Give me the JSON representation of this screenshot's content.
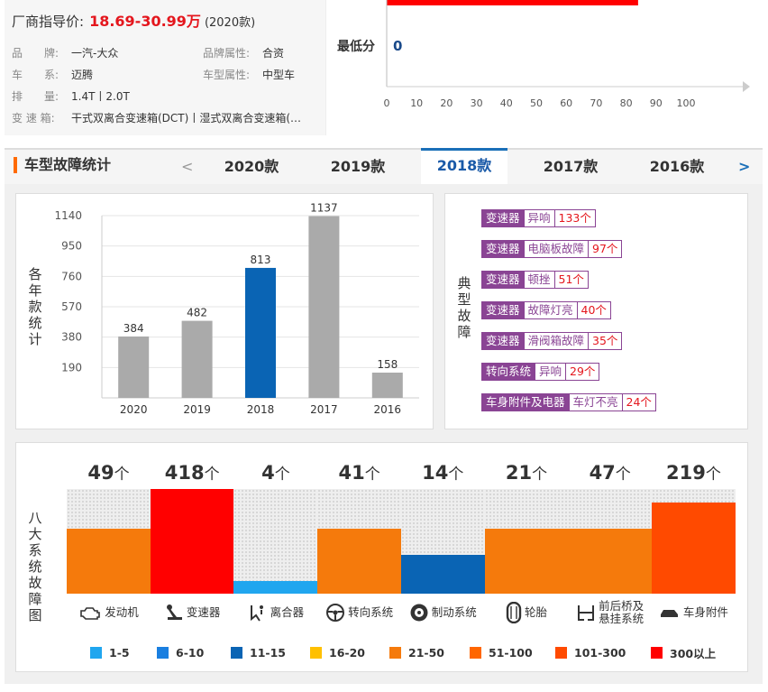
{
  "car": {
    "price_label": "厂商指导价:",
    "price_value": "18.69-30.99万",
    "price_year": "(2020款)",
    "specs_left": [
      {
        "key": "品　　牌:",
        "value": "一汽-大众"
      },
      {
        "key": "车　　系:",
        "value": "迈腾"
      },
      {
        "key": "排　　量:",
        "value": "1.4T丨2.0T"
      },
      {
        "key": "变 速 箱:",
        "value": "干式双离合变速箱(DCT)丨湿式双离合变速箱(…"
      }
    ],
    "specs_right": [
      {
        "key": "品牌属性:",
        "value": "合资"
      },
      {
        "key": "车型属性:",
        "value": "中型车"
      }
    ]
  },
  "score": {
    "label": "最低分",
    "value": "0",
    "axis_ticks": [
      "0",
      "10",
      "20",
      "30",
      "40",
      "50",
      "60",
      "70",
      "80",
      "90",
      "100"
    ],
    "bar_value": 84
  },
  "tabs": {
    "title": "车型故障统计",
    "prev": "<",
    "next": ">",
    "items": [
      "2020款",
      "2019款",
      "2018款",
      "2017款",
      "2016款"
    ],
    "active": "2018款"
  },
  "yearly": {
    "side_label": [
      "各",
      "年",
      "款",
      "统",
      "计"
    ],
    "colors": {
      "normal": "#aaaaaa",
      "active": "#0a64b4"
    },
    "chart_data": {
      "type": "bar",
      "categories": [
        "2020",
        "2019",
        "2018",
        "2017",
        "2016"
      ],
      "values": [
        384,
        482,
        813,
        1137,
        158
      ],
      "highlight": "2018",
      "yticks": [
        190,
        380,
        570,
        760,
        950,
        1140
      ],
      "ylim": [
        0,
        1140
      ],
      "grid": true
    }
  },
  "typical": {
    "side_label": [
      "典",
      "型",
      "故",
      "障"
    ],
    "faults": [
      {
        "component": "变速器",
        "fault": "异响",
        "count": "133个"
      },
      {
        "component": "变速器",
        "fault": "电脑板故障",
        "count": "97个"
      },
      {
        "component": "变速器",
        "fault": "顿挫",
        "count": "51个"
      },
      {
        "component": "变速器",
        "fault": "故障灯亮",
        "count": "40个"
      },
      {
        "component": "变速器",
        "fault": "滑阀箱故障",
        "count": "35个"
      },
      {
        "component": "转向系统",
        "fault": "异响",
        "count": "29个"
      },
      {
        "component": "车身附件及电器",
        "fault": "车灯不亮",
        "count": "24个"
      }
    ]
  },
  "systems": {
    "side_label": [
      "八",
      "大",
      "系",
      "统",
      "故",
      "障",
      "图"
    ],
    "unit": "个",
    "items": [
      {
        "name": "发动机",
        "count": "49",
        "icon": "engine-icon",
        "level": 0.62,
        "color": "#f57a0c"
      },
      {
        "name": "变速器",
        "count": "418",
        "icon": "gear-shift-icon",
        "level": 1.0,
        "color": "#ff0000"
      },
      {
        "name": "离合器",
        "count": "4",
        "icon": "clutch-pedal-icon",
        "level": 0.12,
        "color": "#20a6ef"
      },
      {
        "name": "转向系统",
        "count": "41",
        "icon": "steering-wheel-icon",
        "level": 0.62,
        "color": "#f57a0c"
      },
      {
        "name": "制动系统",
        "count": "14",
        "icon": "brake-disc-icon",
        "level": 0.37,
        "color": "#0a64b4"
      },
      {
        "name": "轮胎",
        "count": "21",
        "icon": "tire-icon",
        "level": 0.62,
        "color": "#f57a0c"
      },
      {
        "name": "前后桥及\n悬挂系统",
        "count": "47",
        "icon": "suspension-icon",
        "level": 0.62,
        "color": "#f57a0c"
      },
      {
        "name": "车身附件",
        "count": "219",
        "icon": "car-body-icon",
        "level": 0.87,
        "color": "#ff4a00"
      }
    ]
  },
  "legend": [
    {
      "label": "1-5",
      "color": "#20a6ef"
    },
    {
      "label": "6-10",
      "color": "#1a7fe0"
    },
    {
      "label": "11-15",
      "color": "#0a64b4"
    },
    {
      "label": "16-20",
      "color": "#ffc000"
    },
    {
      "label": "21-50",
      "color": "#f57a0c"
    },
    {
      "label": "51-100",
      "color": "#ff6600"
    },
    {
      "label": "101-300",
      "color": "#ff4a00"
    },
    {
      "label": "300以上",
      "color": "#ff0000"
    }
  ]
}
